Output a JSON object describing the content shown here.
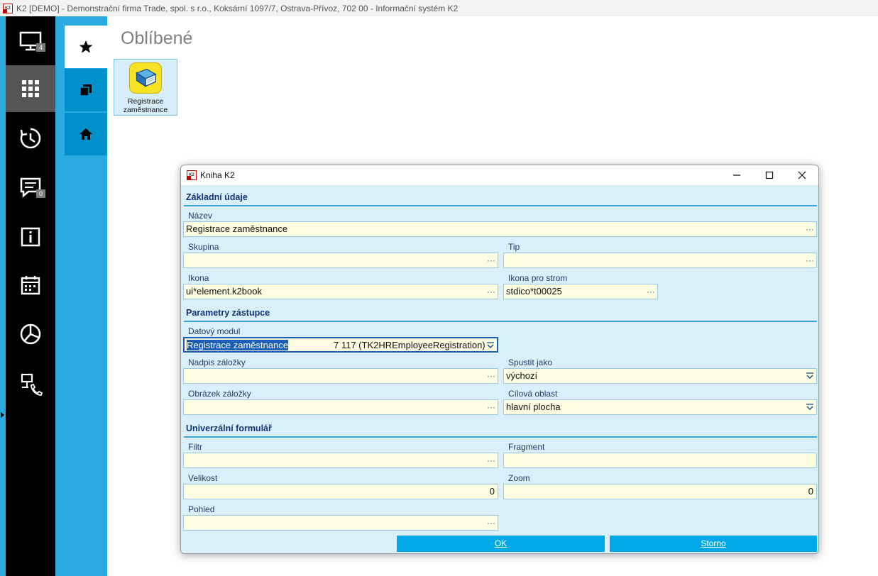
{
  "window": {
    "title": "K2 [DEMO] - Demonstrační firma Trade, spol. s r.o., Koksární 1097/7, Ostrava-Přívoz, 702 00 - Informační systém K2",
    "logo": "k2-logo"
  },
  "sidebar": {
    "items": [
      {
        "icon": "monitor-icon",
        "badge": "4"
      },
      {
        "icon": "apps-grid-icon",
        "active": true
      },
      {
        "icon": "history-icon"
      },
      {
        "icon": "message-icon",
        "badge": "0"
      },
      {
        "icon": "info-icon"
      },
      {
        "icon": "calendar-icon"
      },
      {
        "icon": "pie-chart-icon"
      },
      {
        "icon": "network-phone-icon"
      }
    ]
  },
  "tabs": [
    {
      "icon": "star-icon",
      "active": true
    },
    {
      "icon": "copy-windows-icon"
    },
    {
      "icon": "home-icon"
    }
  ],
  "favorites": {
    "title": "Oblíbené",
    "tiles": [
      {
        "label": "Registrace zaměstnance",
        "icon": "book-icon"
      }
    ]
  },
  "dialog": {
    "title": "Kniha K2",
    "sections": {
      "basic": "Základní údaje",
      "proxy": "Parametry zástupce",
      "universal": "Univerzální formulář"
    },
    "fields": {
      "nazev": {
        "label": "Název",
        "value": "Registrace zaměstnance"
      },
      "skupina": {
        "label": "Skupina",
        "value": ""
      },
      "tip": {
        "label": "Tip",
        "value": ""
      },
      "ikona": {
        "label": "Ikona",
        "value": "ui*element.k2book"
      },
      "ikona_strom": {
        "label": "Ikona pro strom",
        "value": "stdico*t00025"
      },
      "datovy_modul": {
        "label": "Datový modul",
        "value": "Registrace zaměstnance",
        "detail": "7 117 (TK2HREmployeeRegistration)"
      },
      "nadpis_zalozky": {
        "label": "Nadpis záložky",
        "value": ""
      },
      "spustit_jako": {
        "label": "Spustit jako",
        "value": "výchozí"
      },
      "obrazek_zalozky": {
        "label": "Obrázek záložky",
        "value": ""
      },
      "cilova_oblast": {
        "label": "Cílová oblast",
        "value": "hlavní plocha"
      },
      "filtr": {
        "label": "Filtr",
        "value": ""
      },
      "fragment": {
        "label": "Fragment",
        "value": ""
      },
      "velikost": {
        "label": "Velikost",
        "value": "0"
      },
      "zoom": {
        "label": "Zoom",
        "value": "0"
      },
      "pohled": {
        "label": "Pohled",
        "value": ""
      }
    },
    "ellipsis": "···",
    "buttons": {
      "ok": "OK",
      "storno": "Storno"
    }
  },
  "colors": {
    "accent": "#29abe2",
    "sidebar_bg": "#000000",
    "dialog_bg": "#d9effa",
    "field_bg": "#fdfde1",
    "section_title": "#12347a",
    "button": "#00a8e8"
  }
}
